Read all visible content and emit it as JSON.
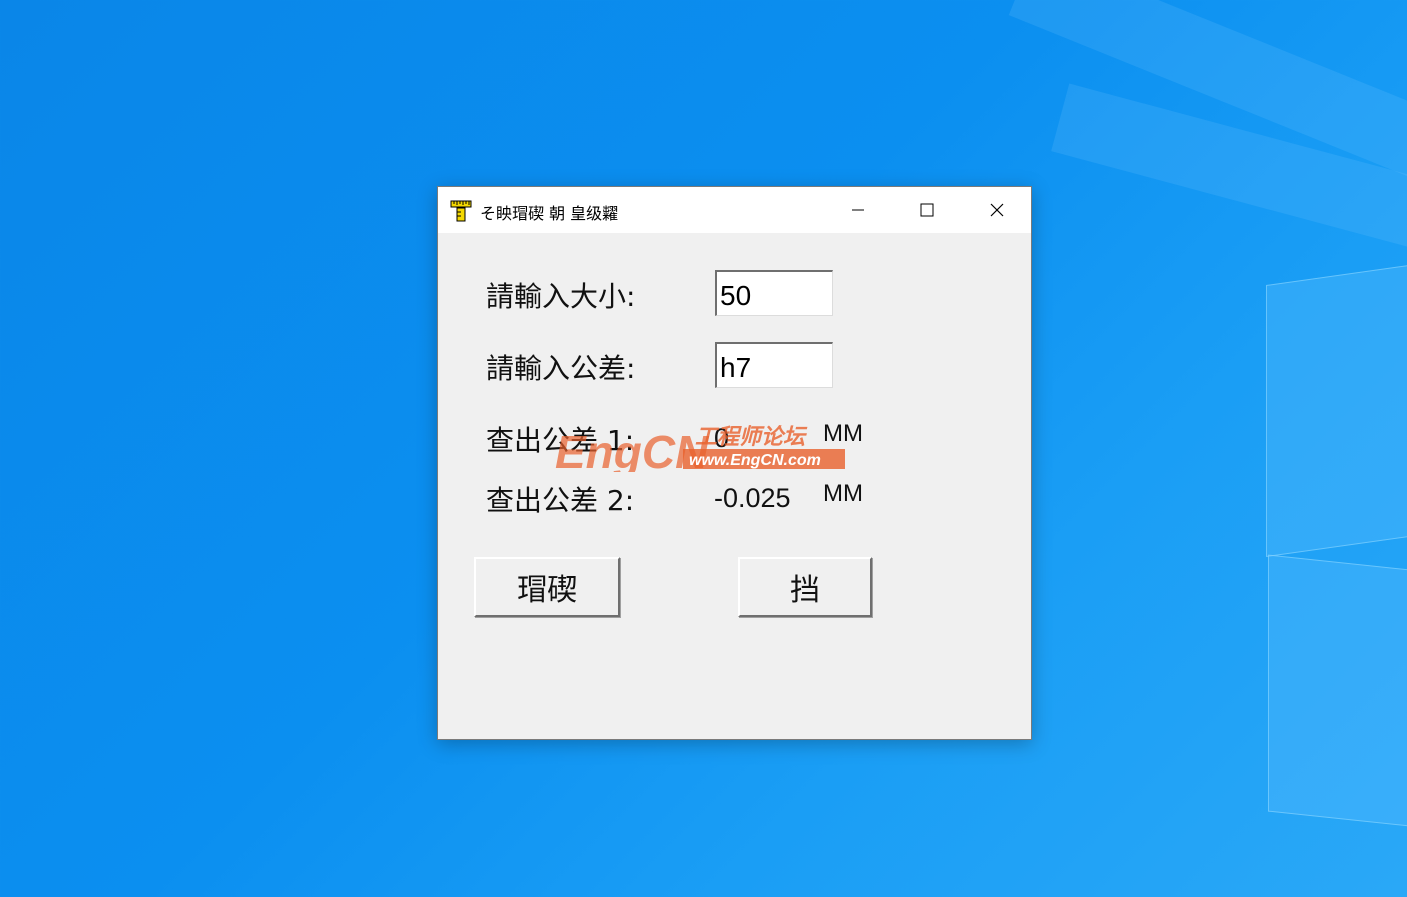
{
  "window": {
    "title": "そ眏瑁碶 朝  皇级糶",
    "controls": {
      "minimize": "minimize-icon",
      "maximize": "maximize-icon",
      "close": "close-icon"
    }
  },
  "form": {
    "size_label": "請輸入大小:",
    "size_value": "50",
    "tolerance_label": "請輸入公差:",
    "tolerance_value": "h7",
    "result1_label": "查出公差  1:",
    "result1_value": "0",
    "result1_unit": "MM",
    "result2_label": "查出公差  2:",
    "result2_value": "-0.025",
    "result2_unit": "MM"
  },
  "buttons": {
    "confirm_label": "瑁碶",
    "exit_label": "挡"
  },
  "watermark": {
    "brand": "EngCN",
    "chinese": "工程师论坛",
    "url": "www.EngCN.com",
    "color": "#e8602c"
  },
  "colors": {
    "desktop": "#0b8ff0",
    "window_bg": "#f0f0f0",
    "titlebar_bg": "#ffffff"
  }
}
